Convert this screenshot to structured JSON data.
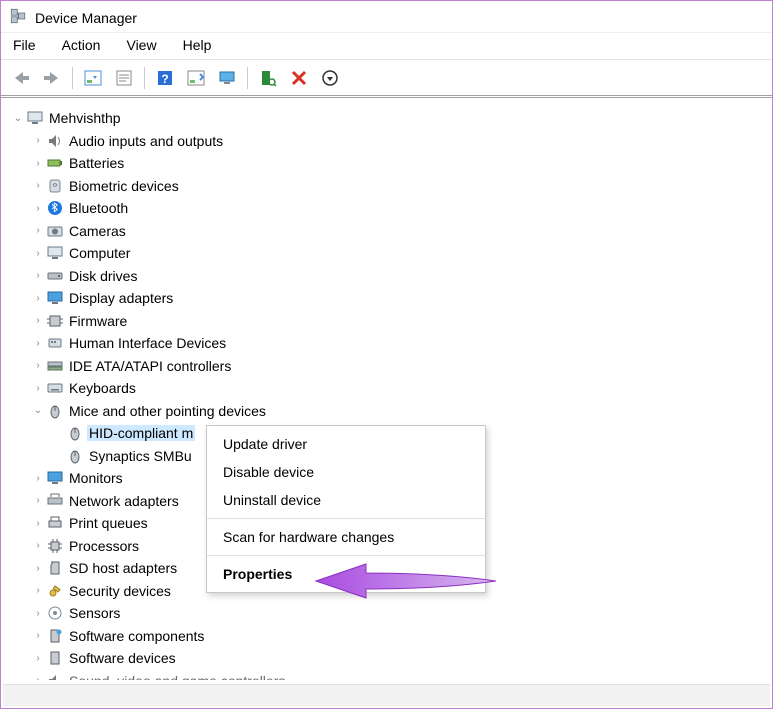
{
  "window": {
    "title": "Device Manager"
  },
  "menu": {
    "file": "File",
    "action": "Action",
    "view": "View",
    "help": "Help"
  },
  "toolbar_icons": {
    "back": "back-arrow-icon",
    "fwd": "forward-arrow-icon",
    "props": "properties-page-icon",
    "console": "console-tree-icon",
    "helpblue": "help-blue-icon",
    "helplist": "help-list-icon",
    "monitor": "monitor-icon",
    "scan": "scan-hardware-icon",
    "remove": "remove-device-icon",
    "more": "more-options-icon"
  },
  "root": "Mehvishthp",
  "categories": [
    "Audio inputs and outputs",
    "Batteries",
    "Biometric devices",
    "Bluetooth",
    "Cameras",
    "Computer",
    "Disk drives",
    "Display adapters",
    "Firmware",
    "Human Interface Devices",
    "IDE ATA/ATAPI controllers",
    "Keyboards",
    "Mice and other pointing devices",
    "Monitors",
    "Network adapters",
    "Print queues",
    "Processors",
    "SD host adapters",
    "Security devices",
    "Sensors",
    "Software components",
    "Software devices",
    "Sound, video and game controllers"
  ],
  "mice_children": {
    "hid": "HID-compliant m",
    "syn": "Synaptics SMBu"
  },
  "context_menu": {
    "update": "Update driver",
    "disable": "Disable device",
    "uninstall": "Uninstall device",
    "scan": "Scan for hardware changes",
    "properties": "Properties"
  }
}
